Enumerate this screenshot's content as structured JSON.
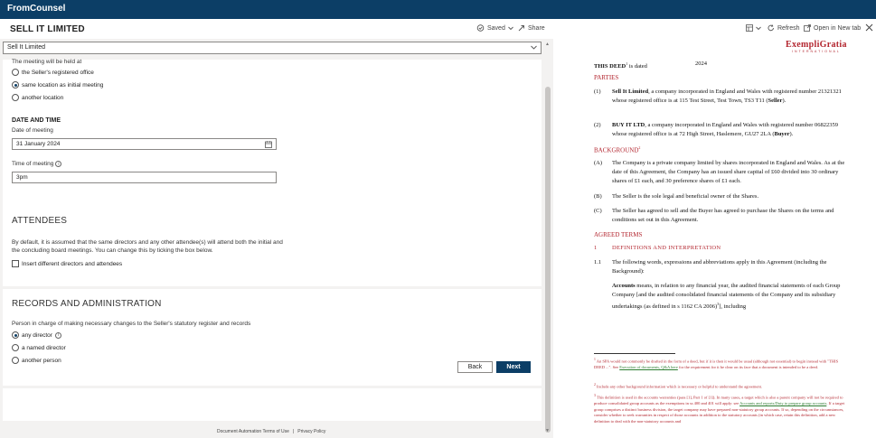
{
  "app": {
    "brand": "FromCounsel"
  },
  "header": {
    "title": "SELL IT LIMITED",
    "saved_label": "Saved",
    "share_label": "Share",
    "refresh_label": "Refresh",
    "open_new_tab_label": "Open in New tab"
  },
  "form": {
    "select_value": "Sell It Limited",
    "meeting_location_label": "The meeting will be held at",
    "location_options": [
      {
        "label": "the Seller's registered office",
        "selected": false
      },
      {
        "label": "same location as initial meeting",
        "selected": true
      },
      {
        "label": "another location",
        "selected": false
      }
    ],
    "date_time_heading": "DATE AND TIME",
    "date_label": "Date of meeting",
    "date_value": "31 January 2024",
    "time_label": "Time of meeting",
    "time_value": "3pm",
    "attendees_heading": "ATTENDEES",
    "attendees_text": "By default, it is assumed that the same directors and any other attendee(s) will attend both the initial and the concluding board meetings. You can change this by ticking the box below.",
    "attendees_checkbox_label": "Insert different directors and attendees",
    "records_heading": "RECORDS AND ADMINISTRATION",
    "records_label": "Person in charge of making necessary changes to the Seller's statutory register and records",
    "records_options": [
      {
        "label": "any director",
        "selected": true
      },
      {
        "label": "a named director",
        "selected": false
      },
      {
        "label": "another person",
        "selected": false
      }
    ],
    "back_label": "Back",
    "next_label": "Next"
  },
  "footer": {
    "links": [
      "Document Automation Terms of Use",
      "Privacy Policy"
    ],
    "separator": "|"
  },
  "document": {
    "logo_main": "ExempliGratia",
    "logo_sub": "INTERNATIONAL",
    "deed_line_label": "THIS DEED",
    "deed_sup": "1",
    "deed_line_mid": " is dated",
    "deed_year": "2024",
    "parties_heading": "PARTIES",
    "parties": [
      {
        "num": "(1)",
        "name": "Sell It Limited",
        "text": ", a company incorporated in England and Wales with registered number 21321321 whose registered office is at 115 Test Street, Test Town, TS3 T11 (",
        "role": "Seller",
        "end": ")."
      },
      {
        "num": "(2)",
        "name": "BUY IT LTD",
        "text": ", a company incorporated in England and Wales with registered number 06822359 whose registered office is at 72 High Street, Haslemere, GU27 2LA (",
        "role": "Buyer",
        "end": ")."
      }
    ],
    "background_heading": "BACKGROUND",
    "background_sup": "2",
    "background_items": [
      {
        "num": "(A)",
        "text": "The Company is a private company limited by shares incorporated in England and Wales. As at the date of this Agreement, the Company has an issued share capital of £60 divided into 30 ordinary shares of £1 each, and 30 preference shares of £1 each."
      },
      {
        "num": "(B)",
        "text": "The Seller is the sole legal and beneficial owner of the Shares."
      },
      {
        "num": "(C)",
        "text": "The Seller has agreed to sell and the Buyer has agreed to purchase the Shares on the terms and conditions set out in this Agreement."
      }
    ],
    "agreed_terms_heading": "AGREED TERMS",
    "clause1_num": "1",
    "clause1_title": "DEFINITIONS AND INTERPRETATION",
    "clause11_num": "1.1",
    "clause11_text": "The following words, expressions and abbreviations apply in this Agreement (including the Background):",
    "accounts_term": "Accounts",
    "accounts_text": " means, in relation to any financial year, the audited financial statements of each Group Company [and the audited consolidated financial statements of the Company and its subsidiary undertakings (as defined in s 1162 CA 2006)",
    "accounts_sup": "3",
    "accounts_end": "], including",
    "footnotes": [
      {
        "sup": "1",
        "pre": " An SPA would not commonly be drafted in the form of a deed, but if it is then it would be usual (although not essential) to begin instead with \"THIS DEED ...\". See ",
        "link": "Execution of documents, Q&A here",
        "post": " for the requirement for it be clear on its face that a document is intended to be a deed."
      },
      {
        "sup": "2",
        "pre": " Include any other background information which is necessary or helpful to understand the agreement.",
        "link": "",
        "post": ""
      },
      {
        "sup": "3",
        "pre": " This definition is used in the accounts warranties (para [1], Part 1 of [1]). In many cases, a target which is also a parent company will not be required to produce consolidated group accounts as the exemptions in ss 400 and 401 will apply: see ",
        "link": "Accounts and reports/Duty to prepare group accounts",
        "post": ". If a target group comprises a distinct business division, the target company may have prepared non-statutory group accounts. If so, depending on the circumstances, consider whether to seek warranties in respect of those accounts in addition to the statutory accounts (in which case, retain this definition, add a new definition to deal with the non-statutory accounts and"
      }
    ]
  },
  "colors": {
    "topbar": "#0c3e66",
    "accent_red": "#b3262f",
    "link_green": "#2e7d32"
  },
  "icons": [
    "save-cloud-icon",
    "share-icon",
    "layout-icon",
    "refresh-icon",
    "open-new-tab-icon",
    "close-icon",
    "calendar-icon",
    "info-icon",
    "chevron-down-icon"
  ]
}
